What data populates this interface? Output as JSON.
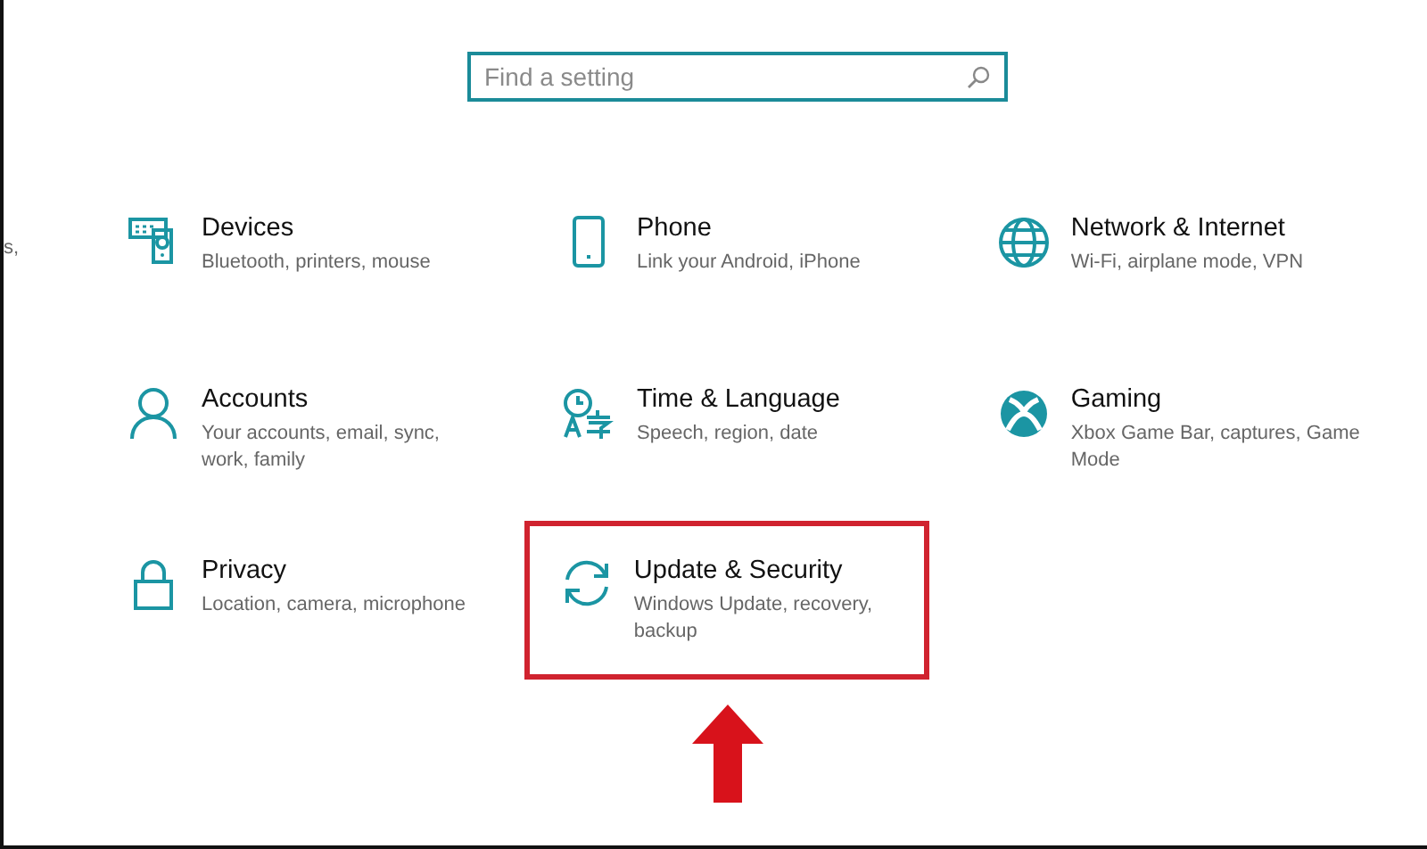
{
  "search": {
    "placeholder": "Find a setting"
  },
  "edge_fragment": "s,",
  "categories": [
    {
      "title": "Devices",
      "description": "Bluetooth, printers, mouse",
      "highlighted": false
    },
    {
      "title": "Phone",
      "description": "Link your Android, iPhone",
      "highlighted": false
    },
    {
      "title": "Network & Internet",
      "description": "Wi-Fi, airplane mode, VPN",
      "highlighted": false
    },
    {
      "title": "Accounts",
      "description": "Your accounts, email, sync, work, family",
      "highlighted": false
    },
    {
      "title": "Time & Language",
      "description": "Speech, region, date",
      "highlighted": false
    },
    {
      "title": "Gaming",
      "description": "Xbox Game Bar, captures, Game Mode",
      "highlighted": false
    },
    {
      "title": "Privacy",
      "description": "Location, camera, microphone",
      "highlighted": false
    },
    {
      "title": "Update & Security",
      "description": "Windows Update, recovery, backup",
      "highlighted": true
    }
  ]
}
